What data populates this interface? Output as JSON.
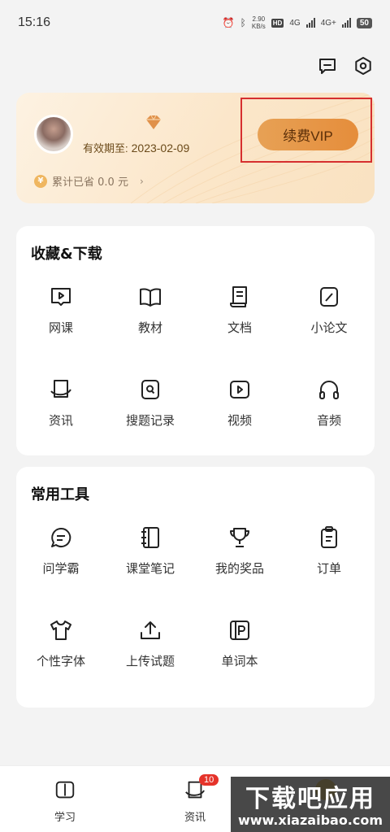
{
  "status": {
    "time": "15:16",
    "net_speed_value": "2.90",
    "net_speed_unit": "KB/s",
    "hd": "HD",
    "net1": "4G",
    "net2": "4G+",
    "battery": "50"
  },
  "vip": {
    "expiry_label": "有效期至:",
    "expiry_date": "2023-02-09",
    "savings_text": "累计已省 0.0 元",
    "coin_symbol": "¥",
    "renew_label": "续费VIP"
  },
  "collections": {
    "title": "收藏&下载",
    "items": [
      {
        "label": "网课",
        "icon": "video-course-icon"
      },
      {
        "label": "教材",
        "icon": "book-icon"
      },
      {
        "label": "文档",
        "icon": "document-icon"
      },
      {
        "label": "小论文",
        "icon": "pen-paper-icon"
      },
      {
        "label": "资讯",
        "icon": "news-icon"
      },
      {
        "label": "搜题记录",
        "icon": "search-record-icon"
      },
      {
        "label": "视频",
        "icon": "video-icon"
      },
      {
        "label": "音频",
        "icon": "headphones-icon"
      }
    ]
  },
  "tools": {
    "title": "常用工具",
    "items": [
      {
        "label": "问学霸",
        "icon": "chat-icon"
      },
      {
        "label": "课堂笔记",
        "icon": "notebook-icon"
      },
      {
        "label": "我的奖品",
        "icon": "trophy-icon"
      },
      {
        "label": "订单",
        "icon": "clipboard-icon"
      },
      {
        "label": "个性字体",
        "icon": "tshirt-icon"
      },
      {
        "label": "上传试题",
        "icon": "upload-icon"
      },
      {
        "label": "单词本",
        "icon": "word-book-icon"
      }
    ]
  },
  "tabbar": {
    "study": "学习",
    "news": "资讯",
    "news_badge": "10"
  },
  "watermark": {
    "main": "下载吧应用",
    "url": "www.xiazaibao.com"
  }
}
